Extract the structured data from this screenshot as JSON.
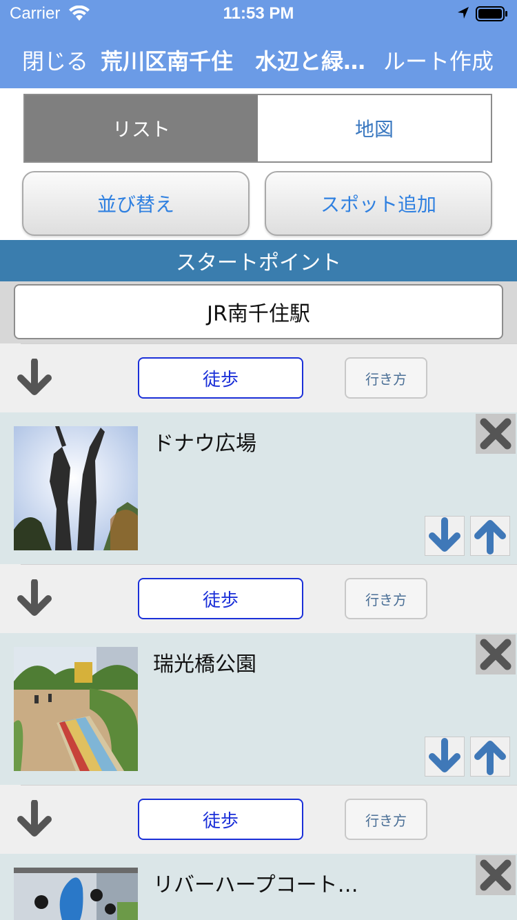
{
  "status_bar": {
    "carrier": "Carrier",
    "time": "11:53 PM"
  },
  "nav": {
    "close_label": "閉じる",
    "title": "荒川区南千住　水辺と緑…",
    "route_label": "ルート作成"
  },
  "tabs": {
    "list_label": "リスト",
    "map_label": "地図",
    "selected": "list"
  },
  "actions": {
    "sort_label": "並び替え",
    "add_spot_label": "スポット追加"
  },
  "start": {
    "header": "スタートポイント",
    "name": "JR南千住駅"
  },
  "transit": {
    "mode_label": "徒歩",
    "directions_label": "行き方"
  },
  "spots": [
    {
      "name": "ドナウ広場"
    },
    {
      "name": "瑞光橋公園"
    },
    {
      "name": "リバーハープコート…"
    }
  ],
  "colors": {
    "header": "#6b9be6",
    "start_header": "#3a7dae",
    "spot_bg": "#dbe6e8",
    "arrow": "#3f78b8"
  }
}
